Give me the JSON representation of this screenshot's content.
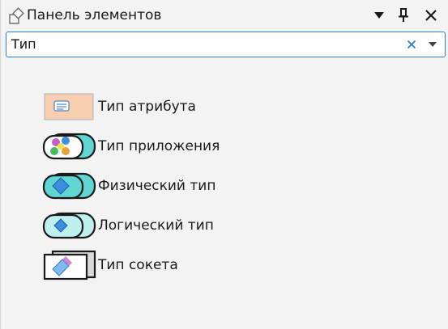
{
  "panel": {
    "title": "Панель элементов",
    "icons": {
      "title": "toolbox-icon",
      "menu": "dropdown-menu-icon",
      "pin": "pin-icon",
      "close": "close-icon"
    }
  },
  "search": {
    "value": "Тип",
    "clear_icon": "clear-x-icon",
    "dropdown_icon": "chevron-down-icon"
  },
  "items": [
    {
      "label": "Тип атрибута",
      "icon": "attribute-type-icon"
    },
    {
      "label": "Тип приложения",
      "icon": "application-type-icon"
    },
    {
      "label": "Физический тип",
      "icon": "physical-type-icon"
    },
    {
      "label": "Логический тип",
      "icon": "logical-type-icon"
    },
    {
      "label": "Тип сокета",
      "icon": "socket-type-icon"
    }
  ],
  "colors": {
    "accent": "#2a7fd2",
    "clear_x": "#2a7fd2",
    "teal": "#5fd6d2",
    "blue_diamond": "#3a8fdf",
    "attr_bg": "#f7cfb0"
  }
}
